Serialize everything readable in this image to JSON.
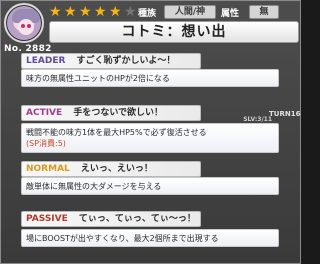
{
  "header": {
    "rarity_stars_filled": 5,
    "rarity_stars_total": 6,
    "card_number": "No. 2882",
    "race_label": "種族",
    "race_value": "人間/神",
    "attribute_label": "属性",
    "attribute_value": "無",
    "title": "コトミ：想い出"
  },
  "skills": {
    "leader": {
      "tag": "LEADER",
      "name": "すごく恥ずかしいよ～！",
      "description": "味方の無属性ユニットのHPが2倍になる"
    },
    "active": {
      "tag": "ACTIVE",
      "name": "手をつないで欲しい！",
      "level": "SLV:3/11",
      "turns": "TURN16",
      "description": "戦闘不能の味方1体を最大HP5%で必ず復活させる",
      "sp_cost": "(SP消費:5)"
    },
    "normal": {
      "tag": "NORMAL",
      "name": "えいっ、えいっ！",
      "description": "敵単体に無属性の大ダメージを与える"
    },
    "passive": {
      "tag": "PASSIVE",
      "name": "てぃっ、てぃっ、てぃ～っ！",
      "description": "場にBOOSTが出やすくなり、最大2個所まで出現する"
    }
  },
  "colors": {
    "star": "#f2b61b",
    "leader_tag": "#5d4ba7",
    "active_tag": "#a23e8f",
    "normal_tag": "#d99a1d",
    "passive_tag": "#b53a2c"
  }
}
